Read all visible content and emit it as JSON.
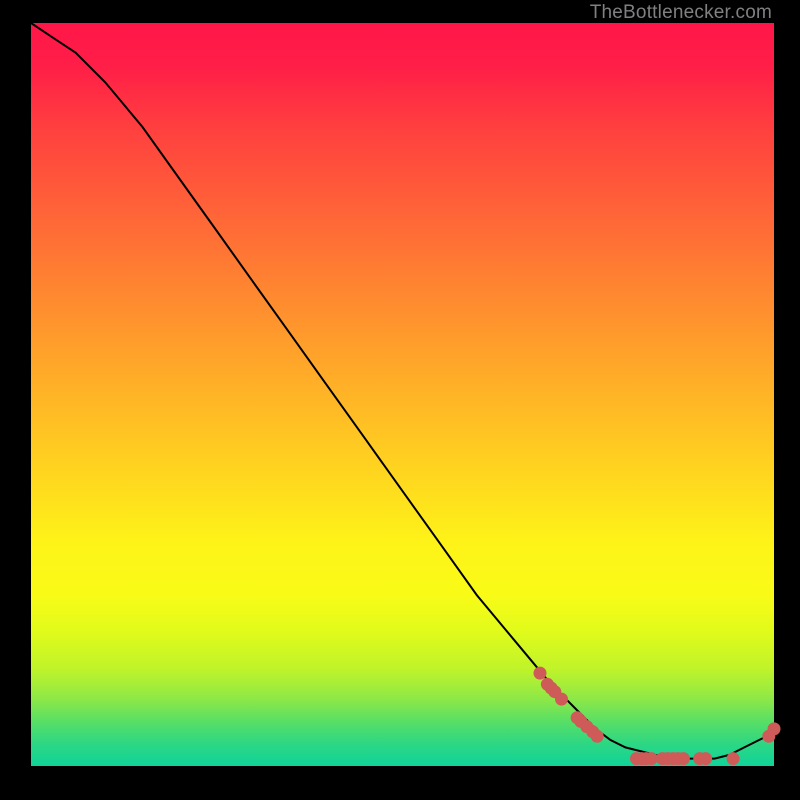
{
  "credit_text": "TheBottlenecker.com",
  "colors": {
    "background": "#000000",
    "curve_stroke": "#000000",
    "marker_fill": "#cf5b59",
    "marker_stroke": "#cf5b59"
  },
  "chart_data": {
    "type": "line",
    "title": "",
    "xlabel": "",
    "ylabel": "",
    "xlim": [
      0,
      100
    ],
    "ylim": [
      0,
      100
    ],
    "series": [
      {
        "name": "bottleneck-curve",
        "x": [
          0,
          3,
          6,
          10,
          15,
          20,
          25,
          30,
          35,
          40,
          45,
          50,
          55,
          60,
          65,
          70,
          72,
          74,
          76,
          78,
          80,
          82,
          84,
          86,
          88,
          90,
          92,
          94,
          96,
          98,
          99,
          100
        ],
        "y": [
          100,
          98,
          96,
          92,
          86,
          79,
          72,
          65,
          58,
          51,
          44,
          37,
          30,
          23,
          17,
          11,
          9,
          7,
          5,
          3.5,
          2.5,
          2,
          1.5,
          1,
          1,
          1,
          1,
          1.5,
          2.5,
          3.5,
          4,
          5
        ]
      }
    ],
    "markers": [
      {
        "name": "cluster-marker",
        "x": 68.5,
        "y": 12.5
      },
      {
        "name": "cluster-marker",
        "x": 69.5,
        "y": 11.0
      },
      {
        "name": "cluster-marker",
        "x": 70.0,
        "y": 10.5
      },
      {
        "name": "cluster-marker",
        "x": 70.5,
        "y": 10.0
      },
      {
        "name": "cluster-marker",
        "x": 71.4,
        "y": 9.0
      },
      {
        "name": "cluster-marker",
        "x": 73.5,
        "y": 6.5
      },
      {
        "name": "cluster-marker",
        "x": 74.0,
        "y": 6.0
      },
      {
        "name": "cluster-marker",
        "x": 74.8,
        "y": 5.3
      },
      {
        "name": "cluster-marker",
        "x": 75.6,
        "y": 4.6
      },
      {
        "name": "cluster-marker",
        "x": 76.2,
        "y": 4.0
      },
      {
        "name": "cluster-marker",
        "x": 81.5,
        "y": 1.0
      },
      {
        "name": "cluster-marker",
        "x": 82.2,
        "y": 1.0
      },
      {
        "name": "cluster-marker",
        "x": 82.8,
        "y": 1.0
      },
      {
        "name": "cluster-marker",
        "x": 83.5,
        "y": 1.0
      },
      {
        "name": "cluster-marker",
        "x": 85.0,
        "y": 1.0
      },
      {
        "name": "cluster-marker",
        "x": 85.7,
        "y": 1.0
      },
      {
        "name": "cluster-marker",
        "x": 86.4,
        "y": 1.0
      },
      {
        "name": "cluster-marker",
        "x": 87.1,
        "y": 1.0
      },
      {
        "name": "cluster-marker",
        "x": 87.8,
        "y": 1.0
      },
      {
        "name": "cluster-marker",
        "x": 90.0,
        "y": 1.0
      },
      {
        "name": "cluster-marker",
        "x": 90.8,
        "y": 1.0
      },
      {
        "name": "cluster-marker",
        "x": 94.5,
        "y": 1.0
      },
      {
        "name": "cluster-marker",
        "x": 99.3,
        "y": 4.0
      },
      {
        "name": "cluster-marker",
        "x": 100.0,
        "y": 5.0
      }
    ]
  }
}
